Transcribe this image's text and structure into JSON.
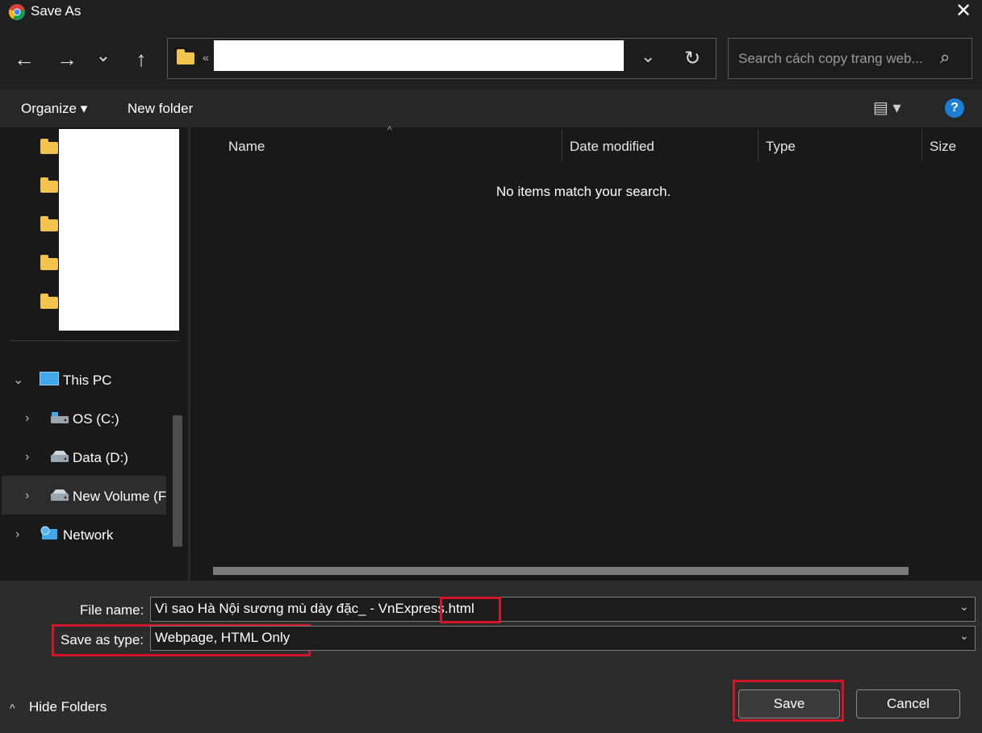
{
  "window": {
    "title": "Save As",
    "close_glyph": "✕"
  },
  "nav": {
    "back": "←",
    "forward": "→",
    "recent": "⌄",
    "up": "↑"
  },
  "address": {
    "prefix": "«",
    "dropdown": "⌄",
    "refresh": "↻"
  },
  "search": {
    "placeholder": "Search cách copy trang web...",
    "icon": "⌕"
  },
  "toolbar": {
    "organize_label": "Organize ▾",
    "new_folder_label": "New folder",
    "view_glyph": "▤ ▾",
    "help_glyph": "?"
  },
  "sidebar": {
    "items": [
      {
        "label": "This PC",
        "icon": "pc-icon"
      },
      {
        "label": "OS (C:)",
        "icon": "drive-icon"
      },
      {
        "label": "Data (D:)",
        "icon": "drive-icon"
      },
      {
        "label": "New Volume (F",
        "icon": "drive-icon"
      },
      {
        "label": "Network",
        "icon": "network-icon"
      }
    ]
  },
  "columns": [
    "Name",
    "Date modified",
    "Type",
    "Size"
  ],
  "file_list": {
    "empty_message": "No items match your search."
  },
  "form": {
    "file_name_label": "File name:",
    "file_name_value": "Vì sao Hà Nội sương mù dày đặc_ - VnExpress.html",
    "save_type_label": "Save as type:",
    "save_type_value": "Webpage, HTML Only",
    "dropdown_glyph": "⌄"
  },
  "footer": {
    "hide_folders_label": "Hide Folders",
    "save_label": "Save",
    "cancel_label": "Cancel"
  },
  "colors": {
    "accent_red": "#d3152a",
    "folder_yellow": "#f2c44d",
    "help_blue": "#1b7fd6"
  }
}
